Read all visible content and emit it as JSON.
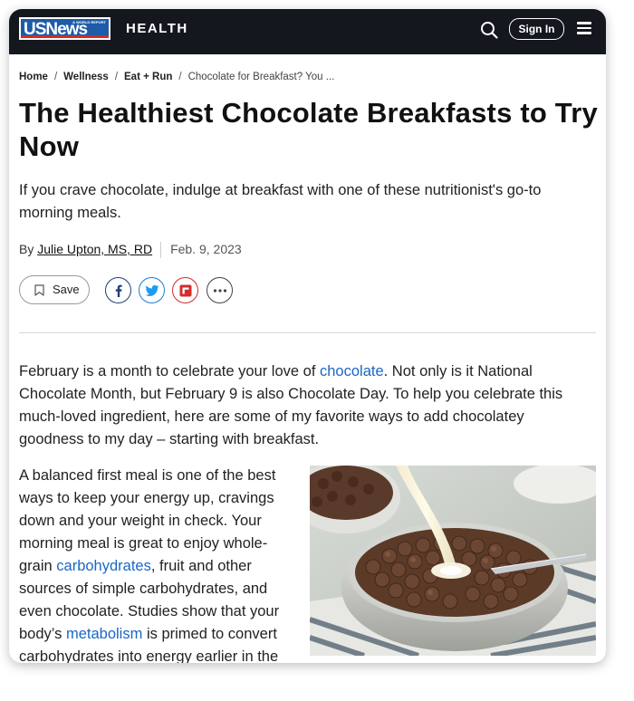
{
  "header": {
    "logo_main": "USNews",
    "logo_small": "& WORLD REPORT",
    "section": "HEALTH",
    "signin_label": "Sign In"
  },
  "breadcrumb": {
    "items": [
      "Home",
      "Wellness",
      "Eat + Run"
    ],
    "separator": "/",
    "current": "Chocolate for Breakfast? You ..."
  },
  "article": {
    "headline": "The Healthiest Chocolate Breakfasts to Try Now",
    "dek": "If you crave chocolate, indulge at breakfast with one of these nutritionist's go-to morning meals.",
    "byline_prefix": "By",
    "author": "Julie Upton, MS, RD",
    "date": "Feb. 9, 2023",
    "save_label": "Save",
    "para1": {
      "t1": "February is a month to celebrate your love of ",
      "link1": "chocolate",
      "t2": ". Not only is it National Chocolate Month, but February 9 is also Chocolate Day. To help you celebrate this much-loved ingredient, here are some of my favorite ways to add chocolatey goodness to my day – starting with breakfast."
    },
    "para2": {
      "t1": "A balanced first meal is one of the best ways to keep your energy up, cravings down and your weight in check. Your morning meal is great to enjoy whole-grain ",
      "link1": "carbohydrates",
      "t2": ", fruit and other sources of simple carbohydrates, and even chocolate. Studies show that your body’s ",
      "link2": "metabolism",
      "t3": " is primed to convert carbohydrates into energy earlier in the"
    }
  },
  "icons": {
    "search": "search-icon",
    "menu": "hamburger-menu-icon",
    "bookmark": "bookmark-icon",
    "facebook": "facebook-icon",
    "twitter": "twitter-icon",
    "flipboard": "flipboard-icon",
    "more": "more-options-icon"
  },
  "colors": {
    "header_bg": "#15171f",
    "logo_blue": "#1e5ba8",
    "logo_red": "#d52b1e",
    "link": "#1a66c7"
  }
}
